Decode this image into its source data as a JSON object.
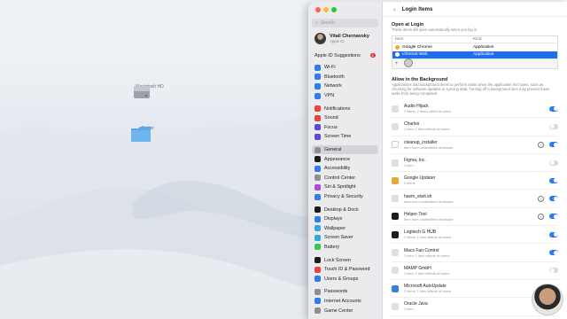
{
  "desktop": {
    "drive_label": "Macintosh HD",
    "folder_label": "Folder"
  },
  "sidebar": {
    "search_placeholder": "Search",
    "user_name": "Vitali Chernavsky",
    "user_sub": "Apple ID",
    "suggestions_label": "Apple ID Suggestions",
    "suggestions_badge": "1",
    "groups": [
      [
        {
          "label": "Wi-Fi",
          "color": "#2d7cf0"
        },
        {
          "label": "Bluetooth",
          "color": "#2d7cf0"
        },
        {
          "label": "Network",
          "color": "#2d7cf0"
        },
        {
          "label": "VPN",
          "color": "#2d7cf0"
        }
      ],
      [
        {
          "label": "Notifications",
          "color": "#e8453c"
        },
        {
          "label": "Sound",
          "color": "#e8453c"
        },
        {
          "label": "Focus",
          "color": "#5b4bd6"
        },
        {
          "label": "Screen Time",
          "color": "#5b4bd6"
        }
      ],
      [
        {
          "label": "General",
          "color": "#8e8e93",
          "selected": true
        },
        {
          "label": "Appearance",
          "color": "#1c1c1e"
        },
        {
          "label": "Accessibility",
          "color": "#2d7cf0"
        },
        {
          "label": "Control Center",
          "color": "#8e8e93"
        },
        {
          "label": "Siri & Spotlight",
          "color": "#b04be0"
        },
        {
          "label": "Privacy & Security",
          "color": "#2d7cf0"
        }
      ],
      [
        {
          "label": "Desktop & Dock",
          "color": "#1c1c1e"
        },
        {
          "label": "Displays",
          "color": "#2d7cf0"
        },
        {
          "label": "Wallpaper",
          "color": "#33a7e0"
        },
        {
          "label": "Screen Saver",
          "color": "#33a7e0"
        },
        {
          "label": "Battery",
          "color": "#34c759"
        }
      ],
      [
        {
          "label": "Lock Screen",
          "color": "#1c1c1e"
        },
        {
          "label": "Touch ID & Password",
          "color": "#e8453c"
        },
        {
          "label": "Users & Groups",
          "color": "#2d7cf0"
        }
      ],
      [
        {
          "label": "Passwords",
          "color": "#8e8e93"
        },
        {
          "label": "Internet Accounts",
          "color": "#2d7cf0"
        },
        {
          "label": "Game Center",
          "color": "#8e8e93"
        }
      ]
    ]
  },
  "main": {
    "title": "Login Items",
    "back_icon": "chevron-left-icon",
    "open_at_login": {
      "heading": "Open at Login",
      "sub": "These items will open automatically when you log in.",
      "col_item": "Item",
      "col_kind": "Kind",
      "rows": [
        {
          "name": "Google Chrome",
          "kind": "Application",
          "color": "#e8a93c",
          "selected": false
        },
        {
          "name": "uTorrent Web",
          "kind": "Application",
          "color": "#ffffff",
          "selected": true
        }
      ],
      "add": "+",
      "remove": "−"
    },
    "background": {
      "heading": "Allow in the Background",
      "sub": "Applications add background items to perform tasks when the application isn't open, such as checking for software updates or syncing data. Turning off a background item may prevent these tasks from being completed",
      "items": [
        {
          "name": "Audio Hijack",
          "sub": "2 items: 2 items affect all users",
          "on": true,
          "info": false,
          "color": "#e0e0e4"
        },
        {
          "name": "Charles",
          "sub": "1 item: 1 item affects all users",
          "on": false,
          "info": false,
          "color": "#e0e0e4"
        },
        {
          "name": "cleanup_installer",
          "sub": "Item from unidentified developer.",
          "on": true,
          "info": true,
          "color": "#ffffff"
        },
        {
          "name": "Figma, Inc.",
          "sub": "1 item",
          "on": false,
          "info": false,
          "color": "#e0e0e4"
        },
        {
          "name": "Google Updater",
          "sub": "2 items",
          "on": true,
          "info": false,
          "color": "#e8a93c"
        },
        {
          "name": "haxm_start.sh",
          "sub": "Item from unidentified developer.",
          "on": true,
          "info": true,
          "color": "#e0e0e4"
        },
        {
          "name": "Helper-Tool",
          "sub": "Item from unidentified developer.",
          "on": true,
          "info": true,
          "color": "#1c1c1e"
        },
        {
          "name": "Logitech G HUB",
          "sub": "2 items: 1 item affects all users",
          "on": true,
          "info": false,
          "color": "#1c1c1e"
        },
        {
          "name": "Macs Fan Control",
          "sub": "1 item: 1 item affects all users",
          "on": true,
          "info": false,
          "color": "#e0e0e4"
        },
        {
          "name": "MAMP GmbH",
          "sub": "1 item: 1 item affects all users",
          "on": false,
          "info": false,
          "color": "#e0e0e4"
        },
        {
          "name": "Microsoft AutoUpdate",
          "sub": "2 items: 1 item affects all users",
          "on": true,
          "info": false,
          "color": "#3b82d6"
        },
        {
          "name": "Oracle Java",
          "sub": "1 item",
          "on": false,
          "info": false,
          "color": "#e0e0e4"
        }
      ]
    }
  }
}
